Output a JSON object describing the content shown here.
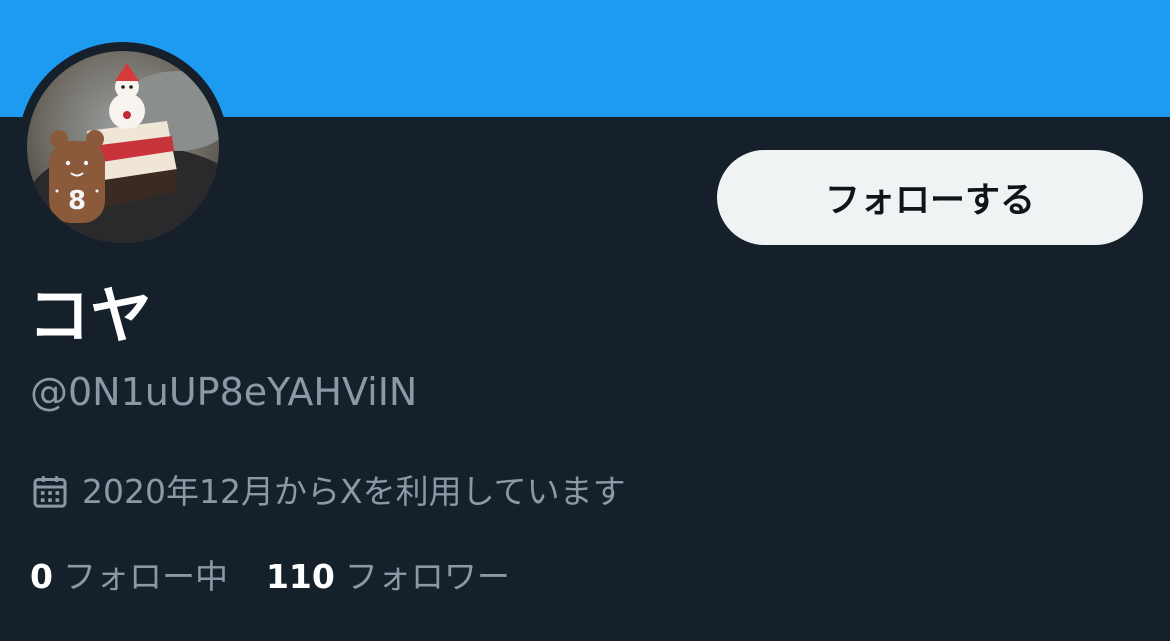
{
  "profile": {
    "display_name": "コヤ",
    "handle": "@0N1uUP8eYAHViIN",
    "follow_button_label": "フォローする",
    "joined_text": "2020年12月からXを利用しています",
    "stats": {
      "following_count": "0",
      "following_label": "フォロー中",
      "followers_count": "110",
      "followers_label": "フォロワー"
    }
  },
  "icons": {
    "joined": "calendar-icon"
  },
  "colors": {
    "banner": "#1d9bf0",
    "background": "#15202b",
    "primary_text": "#ffffff",
    "secondary_text": "#8b98a5",
    "follow_button_bg": "#eff3f4",
    "follow_button_text": "#0f1419"
  }
}
